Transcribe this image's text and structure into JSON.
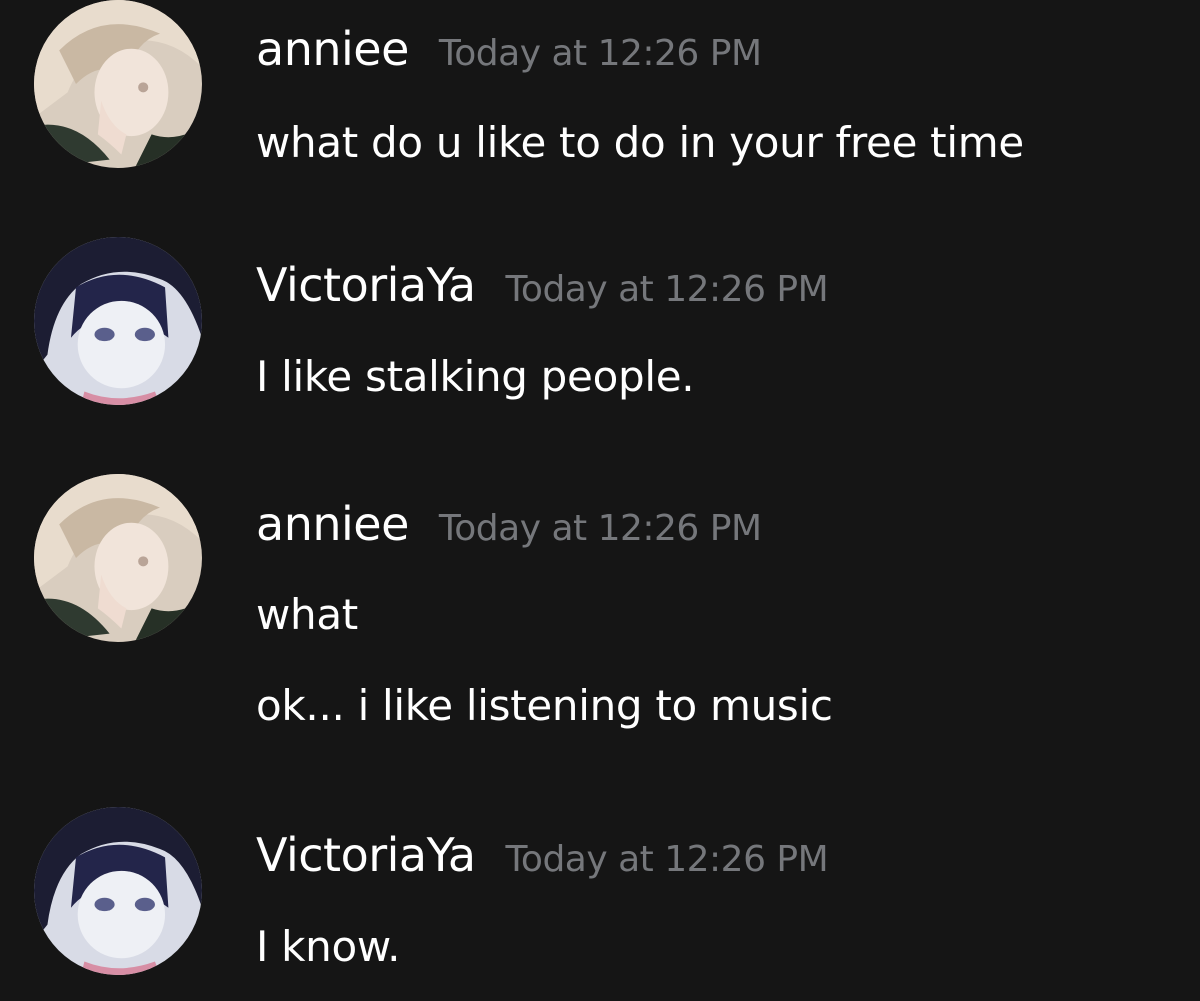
{
  "messages": [
    {
      "author": "anniee",
      "timestamp": "Today at 12:26 PM",
      "lines": [
        "what do u like to do in your free time"
      ]
    },
    {
      "author": "VictoriaYa",
      "timestamp": "Today at 12:26 PM",
      "lines": [
        "I like stalking people."
      ]
    },
    {
      "author": "anniee",
      "timestamp": "Today at 12:26 PM",
      "lines": [
        "what",
        "ok... i like listening to music"
      ]
    },
    {
      "author": "VictoriaYa",
      "timestamp": "Today at 12:26 PM",
      "lines": [
        "I know."
      ]
    }
  ],
  "colors": {
    "background": "#151515",
    "author": "#ffffff",
    "timestamp": "#75777b",
    "message_text": "#ffffff"
  },
  "icons": {
    "anniee_avatar": "avatar-anime-girl-light-hair",
    "victoriaya_avatar": "avatar-anime-girl-dark-hair"
  }
}
